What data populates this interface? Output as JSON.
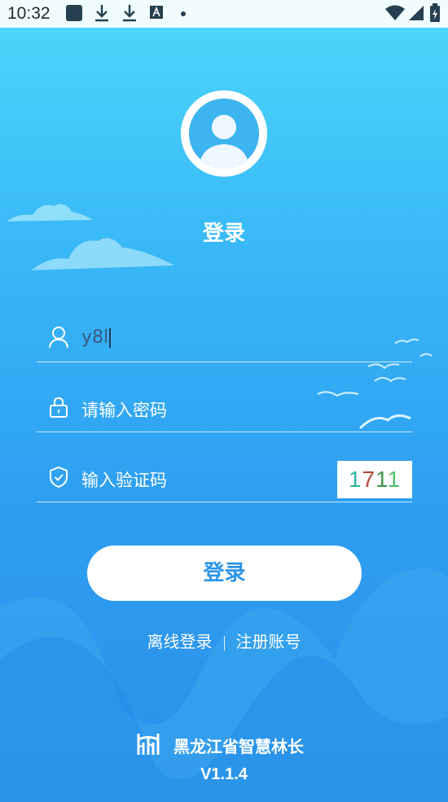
{
  "status_bar": {
    "time": "10:32"
  },
  "login": {
    "title": "登录",
    "username": {
      "value": "y8l"
    },
    "password": {
      "placeholder": "请输入密码"
    },
    "captcha": {
      "placeholder": "输入验证码",
      "code": "1711"
    },
    "submit_label": "登录",
    "offline_login": "离线登录",
    "register": "注册账号"
  },
  "footer": {
    "app_name": "黑龙江省智慧林长",
    "version": "V1.1.4"
  },
  "colors": {
    "accent": "#2c95e8",
    "background_top": "#4fd8fb",
    "background_bottom": "#2a8fe8"
  }
}
